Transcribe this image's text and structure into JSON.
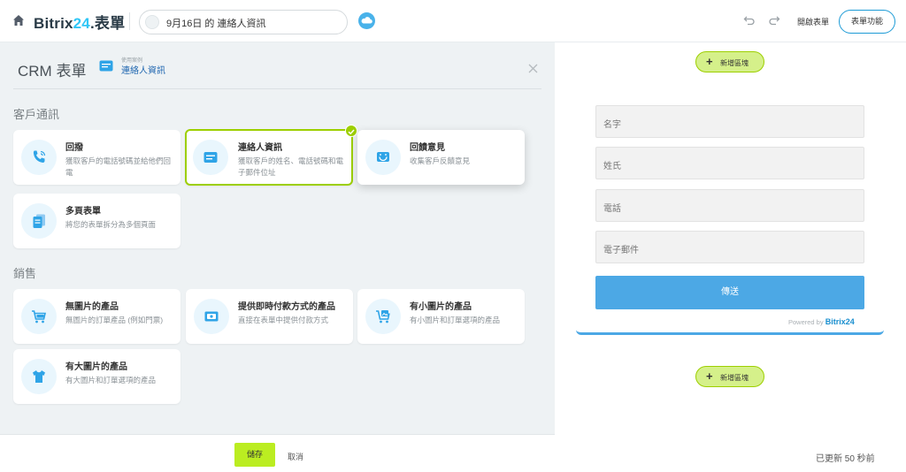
{
  "header": {
    "logo_main": "Bitrix",
    "logo_num": "24",
    "logo_suffix": ".表單",
    "form_title": "9月16日 的 連絡人資訊",
    "open_form": "開啟表單",
    "form_functions": "表單功能",
    "icons": [
      "home-icon",
      "cloud-icon",
      "undo-icon",
      "redo-icon"
    ]
  },
  "left": {
    "title": "CRM 表單",
    "usecase_label": "使用案例",
    "usecase_value": "連絡人資訊",
    "sections": {
      "communication": "客戶通訊",
      "sales": "銷售"
    },
    "cards": [
      {
        "title": "回撥",
        "desc": "獲取客戶的電話號碼並給他們回電",
        "icon": "phone-icon"
      },
      {
        "title": "連絡人資訊",
        "desc": "獲取客戶的姓名、電話號碼和電子郵件位址",
        "icon": "contact-form-icon",
        "selected": true
      },
      {
        "title": "回饋意見",
        "desc": "收集客戶反饋意見",
        "icon": "feedback-icon"
      },
      {
        "title": "多頁表單",
        "desc": "將您的表單拆分為多個頁面",
        "icon": "multipage-icon"
      },
      {
        "title": "無圖片的產品",
        "desc": "無圖片的訂單產品 (例如門票)",
        "icon": "cart-icon"
      },
      {
        "title": "提供即時付款方式的產品",
        "desc": "直接在表單中提供付款方式",
        "icon": "payment-icon"
      },
      {
        "title": "有小圖片的產品",
        "desc": "有小圖片和訂單選項的產品",
        "icon": "cart-image-icon"
      },
      {
        "title": "有大圖片的產品",
        "desc": "有大圖片和訂單選項的產品",
        "icon": "tshirt-icon"
      }
    ],
    "save": "儲存",
    "cancel": "取消"
  },
  "right": {
    "add_block": "新增區塊",
    "fields": [
      "名字",
      "姓氏",
      "電話",
      "電子郵件"
    ],
    "submit": "傳送",
    "powered_by": "Powered by",
    "powered_brand": "Bitrix24",
    "updated": "已更新 50 秒前"
  },
  "colors": {
    "accent_green": "#bbed21",
    "selected_border": "#9dcf00",
    "submit_blue": "#4ca8e5",
    "link_blue": "#2067b0"
  }
}
